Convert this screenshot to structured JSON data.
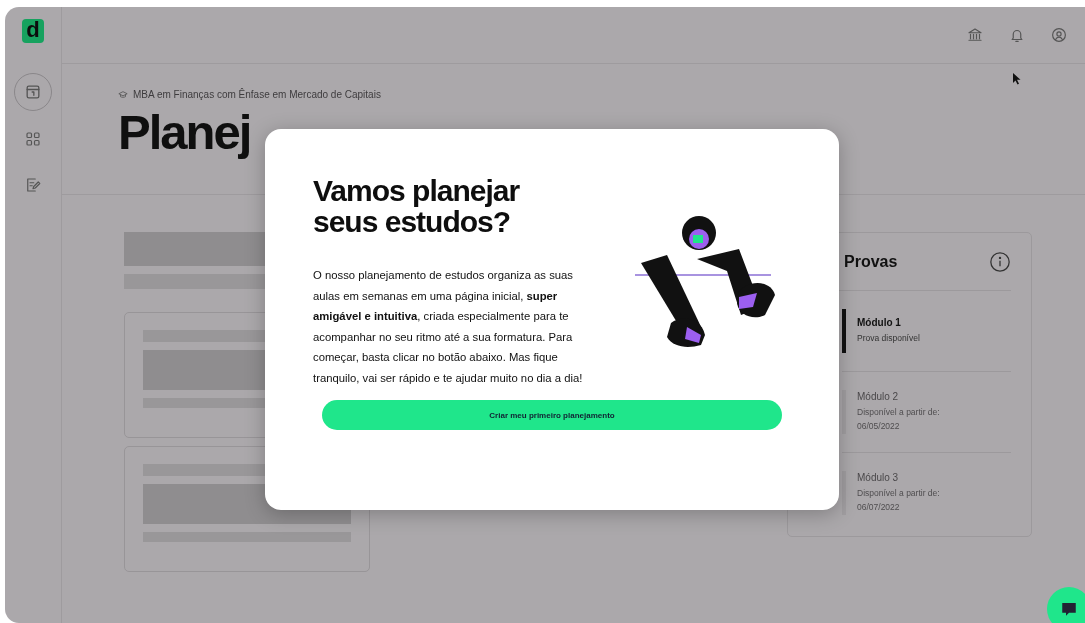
{
  "logo": "d",
  "sidebar": {
    "items": [
      {
        "selected": true
      },
      {
        "selected": false
      },
      {
        "selected": false
      }
    ]
  },
  "breadcrumb": "MBA em Finanças com Ênfase em Mercado de Capitais",
  "page_title": "Planej",
  "exams": {
    "title": "Provas",
    "items": [
      {
        "title": "Módulo 1",
        "status": "Prova disponível",
        "available": true
      },
      {
        "title": "Módulo 2",
        "status": "Disponível a partir de:",
        "date": "06/05/2022",
        "available": false
      },
      {
        "title": "Módulo 3",
        "status": "Disponível a partir de:",
        "date": "06/07/2022",
        "available": false
      }
    ]
  },
  "modal": {
    "title": "Vamos planejar seus estudos?",
    "body": "O nosso planejamento de estudos organiza as suas aulas em semanas em uma página inicial, **super amigável e intuitiva**, criada especialmente para te acompanhar no seu ritmo até a sua formatura. Para começar, basta clicar no botão abaixo. Mas fique tranquilo, vai ser rápido e te ajudar muito no dia a dia!",
    "button": "Criar meu primeiro planejamento"
  }
}
